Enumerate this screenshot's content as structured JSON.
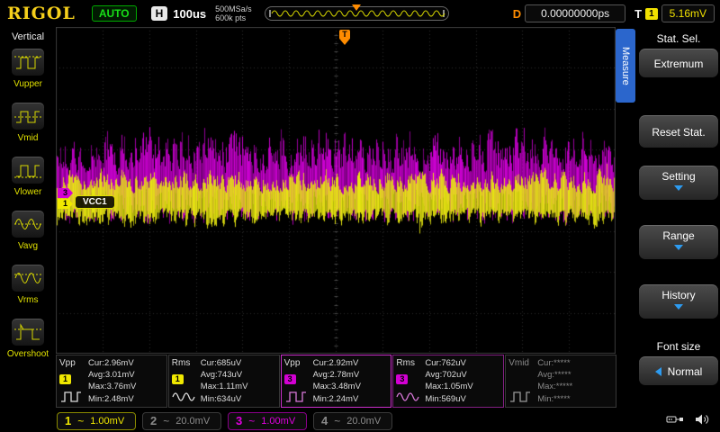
{
  "colors": {
    "ch1": "#f0e800",
    "ch3": "#d400d4",
    "trigger": "#ff8c00",
    "menu_accent": "#2d9bf0",
    "run_status": "#18e018"
  },
  "top_bar": {
    "logo": "RIGOL",
    "run_status": "AUTO",
    "h_label": "H",
    "timebase": "100us",
    "sample_rate": "500MSa/s",
    "memory_depth": "600k pts",
    "d_label": "D",
    "delay": "0.00000000ps",
    "t_label": "T",
    "trigger_source": "1",
    "trigger_level": "5.16mV"
  },
  "left_menu": {
    "title": "Vertical",
    "items": [
      {
        "label": "Vupper"
      },
      {
        "label": "Vmid"
      },
      {
        "label": "Vlower"
      },
      {
        "label": "Vavg"
      },
      {
        "label": "Vrms"
      },
      {
        "label": "Overshoot"
      }
    ]
  },
  "grid": {
    "trigger_marker": "T",
    "ch1_marker": "1",
    "ch3_marker": "3",
    "channel_label": "VCC1"
  },
  "right_menu": {
    "tab": "Measure",
    "items": [
      {
        "label": "Stat. Sel.",
        "value": "Extremum"
      },
      {
        "label": "Reset Stat."
      },
      {
        "label": "Setting",
        "arrow": "down"
      },
      {
        "label": "Range",
        "arrow": "down"
      },
      {
        "label": "History",
        "arrow": "down"
      },
      {
        "label": "Font size",
        "value": "Normal",
        "arrow": "left"
      }
    ]
  },
  "measurements": [
    {
      "name": "Vpp",
      "channel": "1",
      "icon_color": "#dddddd",
      "values": {
        "cur": "Cur:2.96mV",
        "avg": "Avg:3.01mV",
        "max": "Max:3.76mV",
        "min": "Min:2.48mV"
      }
    },
    {
      "name": "Rms",
      "channel": "1",
      "icon_color": "#dddddd",
      "values": {
        "cur": "Cur:685uV",
        "avg": "Avg:743uV",
        "max": "Max:1.11mV",
        "min": "Min:634uV"
      }
    },
    {
      "name": "Vpp",
      "channel": "3",
      "icon_color": "#d978d9",
      "values": {
        "cur": "Cur:2.92mV",
        "avg": "Avg:2.78mV",
        "max": "Max:3.48mV",
        "min": "Min:2.24mV"
      }
    },
    {
      "name": "Rms",
      "channel": "3",
      "icon_color": "#d978d9",
      "values": {
        "cur": "Cur:762uV",
        "avg": "Avg:702uV",
        "max": "Max:1.05mV",
        "min": "Min:569uV"
      }
    },
    {
      "name": "Vmid",
      "channel": "",
      "icon_color": "#999999",
      "values": {
        "cur": "Cur:*****",
        "avg": "Avg:*****",
        "max": "Max:*****",
        "min": "Min:*****"
      }
    }
  ],
  "channel_bar": {
    "channels": [
      {
        "num": "1",
        "coupling": "~",
        "scale": "1.00mV",
        "active": true
      },
      {
        "num": "2",
        "coupling": "~",
        "scale": "20.0mV",
        "active": false
      },
      {
        "num": "3",
        "coupling": "~",
        "scale": "1.00mV",
        "active": true
      },
      {
        "num": "4",
        "coupling": "~",
        "scale": "20.0mV",
        "active": false
      }
    ]
  }
}
